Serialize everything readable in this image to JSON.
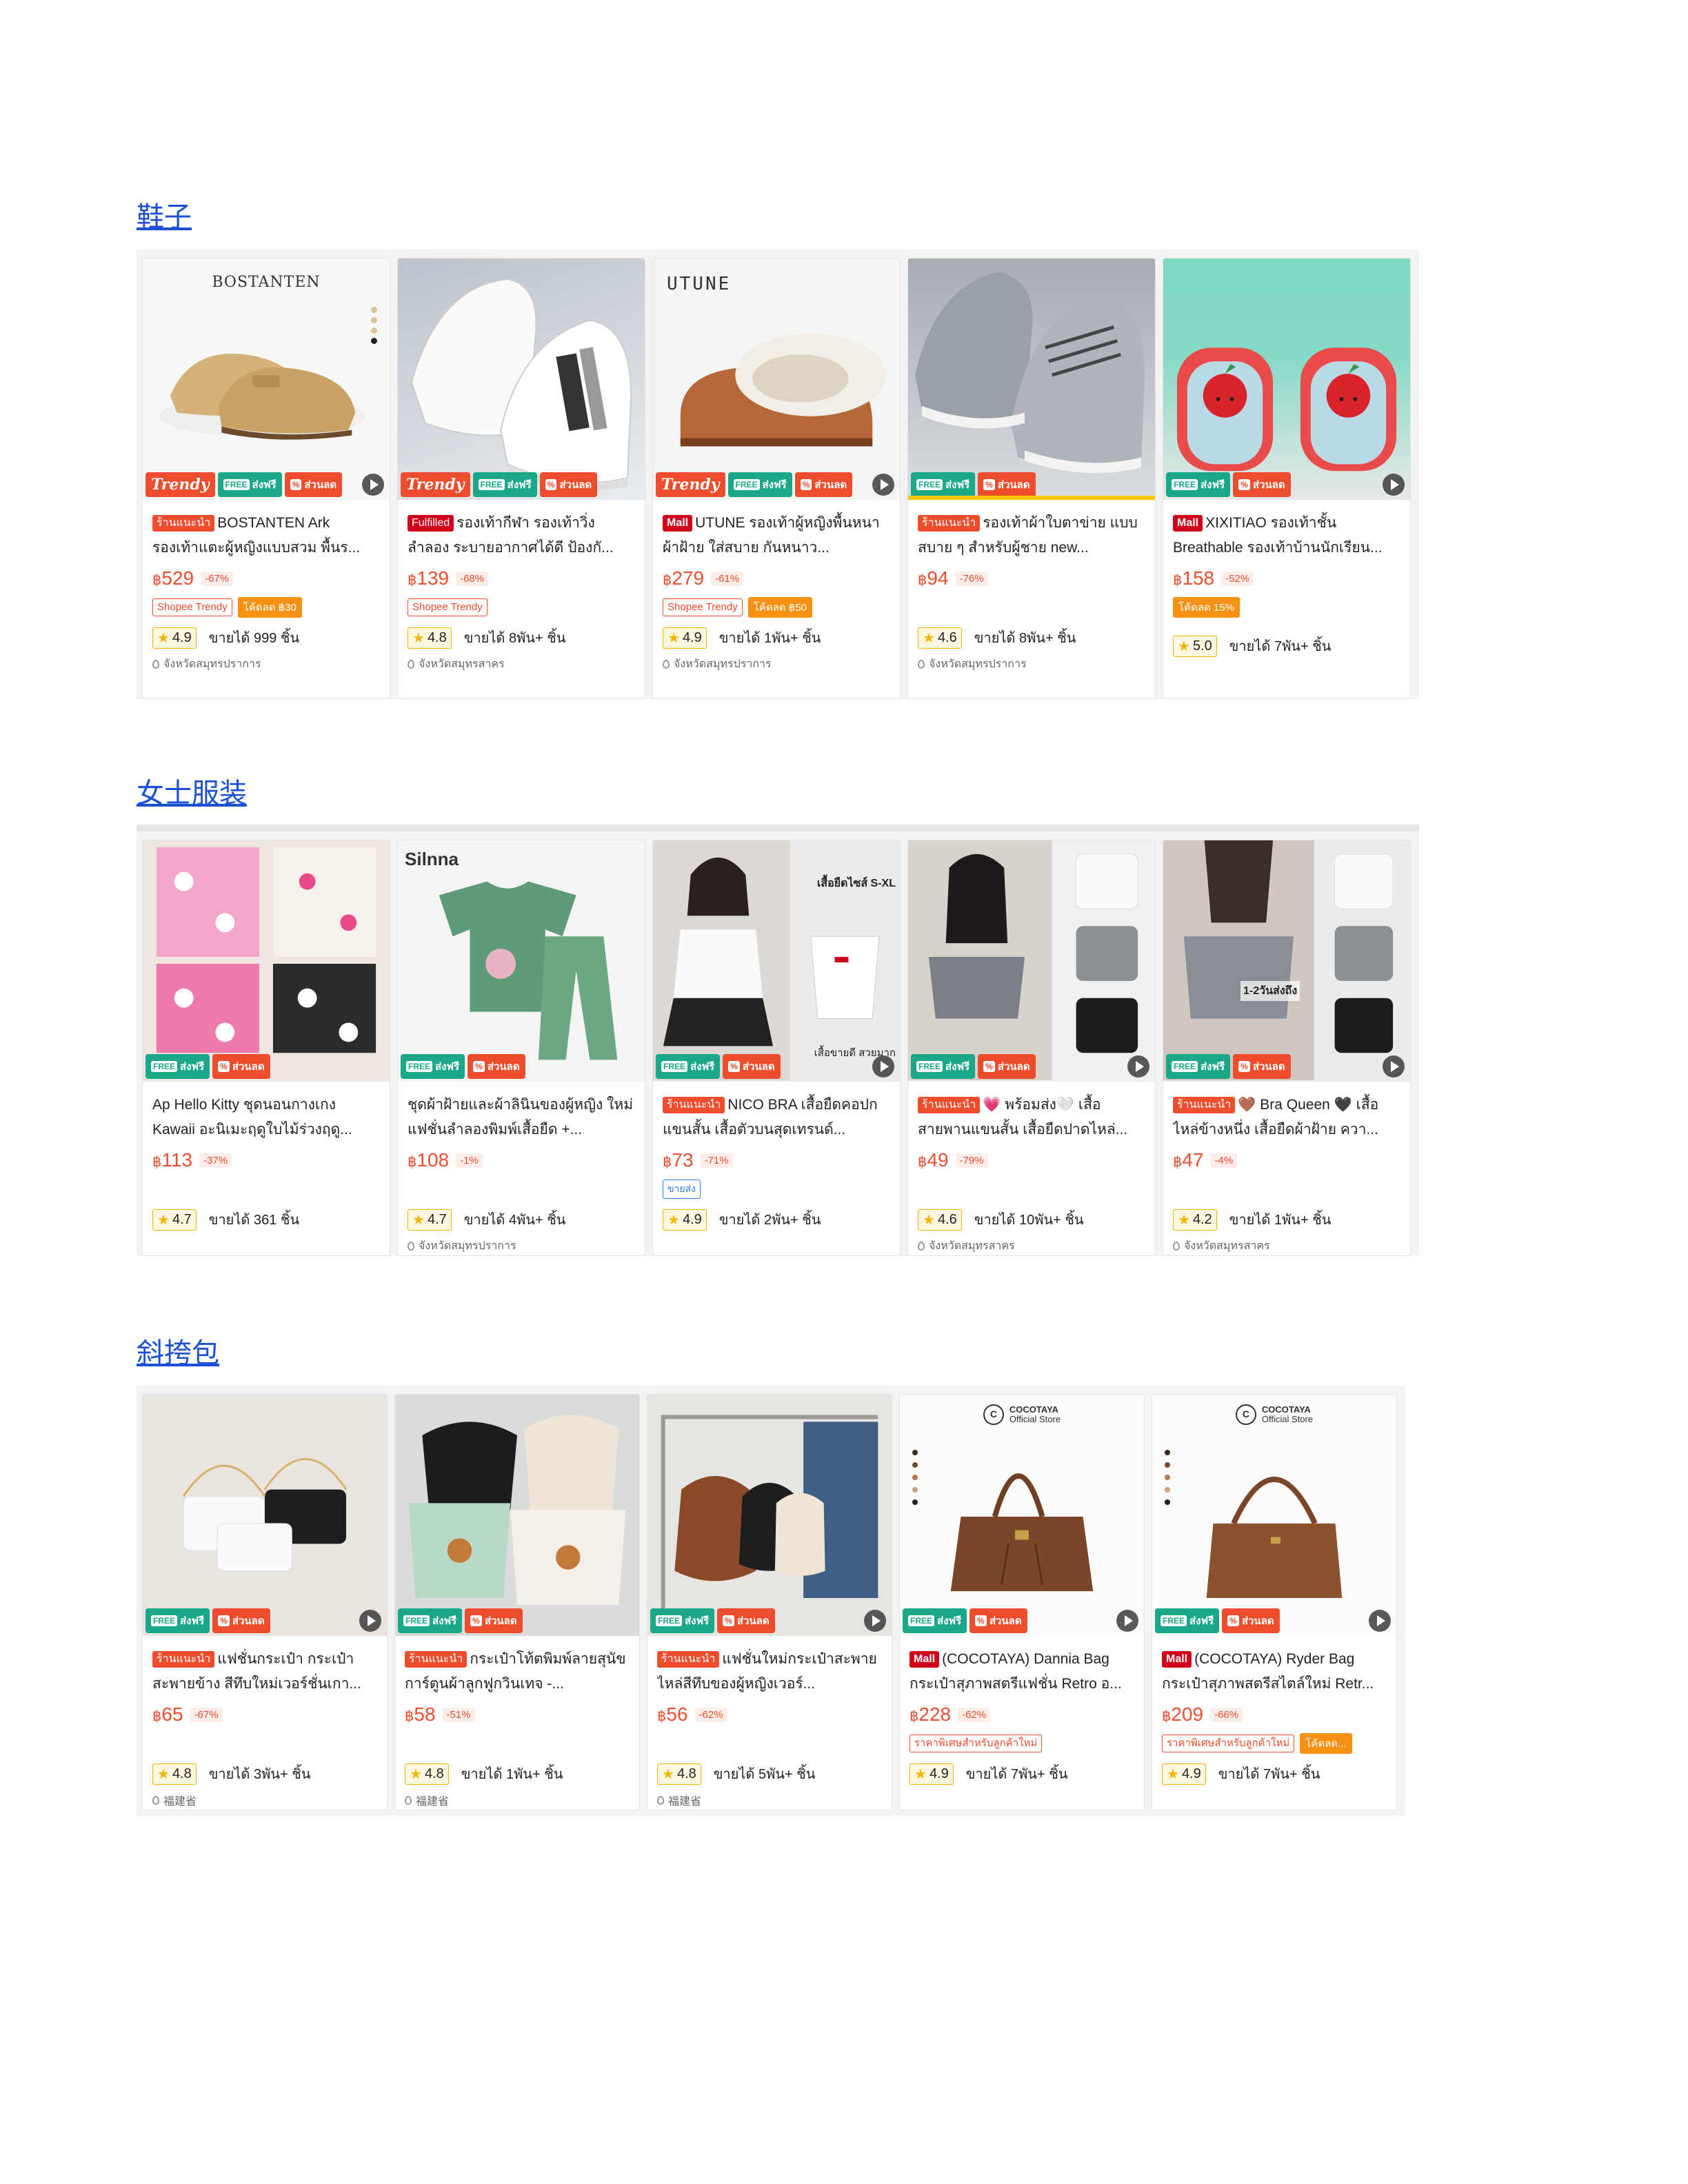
{
  "colors": {
    "accent": "#ee4d2d",
    "link": "#1a4fd6",
    "free_shipping": "#1aa889",
    "rating": "#f5b400"
  },
  "sections": [
    {
      "heading": "鞋子",
      "cards": [
        {
          "brand": "BOSTANTEN",
          "tag": "ร้านแนะนำ",
          "title": "BOSTANTEN Ark รองเท้าแตะผู้หญิงแบบสวม พื้นร...",
          "currency": "฿",
          "price": "529",
          "discount": "-67%",
          "chip1": "Shopee Trendy",
          "chip2": "โค้ดลด ฿30",
          "rating": "4.9",
          "sold": "ขายได้ 999 ชิ้น",
          "location": "จังหวัดสมุทรปราการ"
        },
        {
          "tag": "Fulfilled",
          "title": "รองเท้ากีฬา รองเท้าวิ่ง ลำลอง ระบายอากาศได้ดี ป้องกั...",
          "currency": "฿",
          "price": "139",
          "discount": "-68%",
          "chip1": "Shopee Trendy",
          "rating": "4.8",
          "sold": "ขายได้ 8พัน+ ชิ้น",
          "location": "จังหวัดสมุทรสาคร"
        },
        {
          "brand": "UTUNE",
          "tag": "Mall",
          "title": "UTUNE รองเท้าผู้หญิงพื้นหนา ผ้าฝ้าย ใส่สบาย กันหนาว...",
          "currency": "฿",
          "price": "279",
          "discount": "-61%",
          "chip1": "Shopee Trendy",
          "chip2": "โค้ดลด ฿50",
          "rating": "4.9",
          "sold": "ขายได้ 1พัน+ ชิ้น",
          "location": "จังหวัดสมุทรปราการ"
        },
        {
          "tag": "ร้านแนะนำ",
          "title": "รองเท้าผ้าใบตาข่าย แบบสบาย ๆ สำหรับผู้ชาย new...",
          "currency": "฿",
          "price": "94",
          "discount": "-76%",
          "rating": "4.6",
          "sold": "ขายได้ 8พัน+ ชิ้น",
          "location": "จังหวัดสมุทรปราการ"
        },
        {
          "tag": "Mall",
          "title": "XIXITIAO รองเท้าชั้น Breathable รองเท้าบ้านนักเรียน...",
          "currency": "฿",
          "price": "158",
          "discount": "-52%",
          "chip2": "โค้ดลด 15%",
          "rating": "5.0",
          "sold": "ขายได้ 7พัน+ ชิ้น"
        }
      ]
    },
    {
      "heading": "女士服装",
      "cards": [
        {
          "title": "Ap Hello Kitty ชุดนอนกางเกง Kawaii อะนิเมะฤดูใบไม้ร่วงฤดู...",
          "currency": "฿",
          "price": "113",
          "discount": "-37%",
          "rating": "4.7",
          "sold": "ขายได้ 361 ชิ้น"
        },
        {
          "brand": "Silnna",
          "title": "ชุดผ้าฝ้ายและผ้าลินินของผู้หญิง ใหม่แฟชั่นลำลองพิมพ์เสื้อยืด +...",
          "currency": "฿",
          "price": "108",
          "discount": "-1%",
          "rating": "4.7",
          "sold": "ขายได้ 4พัน+ ชิ้น",
          "location": "จังหวัดสมุทรปราการ"
        },
        {
          "tag": "ร้านแนะนำ",
          "title": "NICO BRA เสื้อยืดคอปกแขนสั้น เสื้อตัวบนสุดเทรนด์...",
          "currency": "฿",
          "price": "73",
          "discount": "-71%",
          "chip_blue": "ขายส่ง",
          "rating": "4.9",
          "sold": "ขายได้ 2พัน+ ชิ้น",
          "overlay1": "เสื้อยืดไซส์ S-XL",
          "overlay2": "เสื้อขายดี สวยมาก"
        },
        {
          "tag": "ร้านแนะนำ",
          "title": "💗 พร้อมส่ง🤍 เสื้อสายพานแขนสั้น เสื้อยืดปาดไหล่...",
          "currency": "฿",
          "price": "49",
          "discount": "-79%",
          "rating": "4.6",
          "sold": "ขายได้ 10พัน+ ชิ้น",
          "location": "จังหวัดสมุทรสาคร"
        },
        {
          "tag": "ร้านแนะนำ",
          "title": "🤎 Bra Queen 🖤 เสื้อไหล่ข้างหนึ่ง เสื้อยืดผ้าฝ้าย ควา...",
          "currency": "฿",
          "price": "47",
          "discount": "-4%",
          "rating": "4.2",
          "sold": "ขายได้ 1พัน+ ชิ้น",
          "location": "จังหวัดสมุทรสาคร",
          "overlay1": "1-2วันส่งถึง"
        }
      ]
    },
    {
      "heading": "斜挎包",
      "cards": [
        {
          "tag": "ร้านแนะนำ",
          "title": "แฟชั่นกระเป๋า กระเป๋าสะพายข้าง สีทึบใหม่เวอร์ชั่นเกา...",
          "currency": "฿",
          "price": "65",
          "discount": "-67%",
          "rating": "4.8",
          "sold": "ขายได้ 3พัน+ ชิ้น",
          "location": "福建省"
        },
        {
          "tag": "ร้านแนะนำ",
          "title": "กระเป๋าโท้ตพิมพ์ลายสุนัขการ์ตูนผ้าลูกฟูกวินเทจ -...",
          "currency": "฿",
          "price": "58",
          "discount": "-51%",
          "rating": "4.8",
          "sold": "ขายได้ 1พัน+ ชิ้น",
          "location": "福建省"
        },
        {
          "tag": "ร้านแนะนำ",
          "title": "แฟชั่นใหม่กระเป๋าสะพายไหล่สีทึบของผู้หญิงเวอร์...",
          "currency": "฿",
          "price": "56",
          "discount": "-62%",
          "rating": "4.8",
          "sold": "ขายได้ 5พัน+ ชิ้น",
          "location": "福建省"
        },
        {
          "brand": "COCOTAYA",
          "brand_sub": "Official Store",
          "tag": "Mall",
          "title": "(COCOTAYA) Dannia Bag กระเป๋าสุภาพสตรีแฟชั่น Retro อ...",
          "currency": "฿",
          "price": "228",
          "discount": "-62%",
          "chip1": "ราคาพิเศษสำหรับลูกค้าใหม่",
          "rating": "4.9",
          "sold": "ขายได้ 7พัน+ ชิ้น"
        },
        {
          "brand": "COCOTAYA",
          "brand_sub": "Official Store",
          "tag": "Mall",
          "title": "(COCOTAYA) Ryder Bag กระเป๋าสุภาพสตรีสไตล์ใหม่ Retr...",
          "currency": "฿",
          "price": "209",
          "discount": "-66%",
          "chip1": "ราคาพิเศษสำหรับลูกค้าใหม่",
          "chip2": "โค้ดลด...",
          "rating": "4.9",
          "sold": "ขายได้ 7พัน+ ชิ้น"
        }
      ]
    }
  ],
  "badges": {
    "trendy": "Trendy",
    "free_ship": "ส่งฟรี",
    "discount": "ส่วนลด",
    "free_ship_sub": "FREE",
    "discount_sub": "%"
  },
  "icons": {
    "play": "play-icon",
    "star": "star-icon",
    "location": "location-pin-icon"
  }
}
